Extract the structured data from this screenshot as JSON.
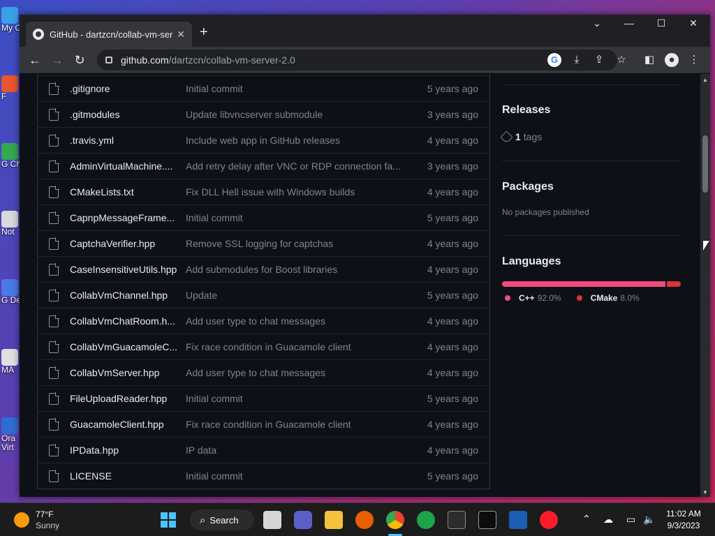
{
  "desktop": {
    "icons": [
      {
        "label": "My C",
        "color": "#3aa0e8"
      },
      {
        "label": "F",
        "color": "#e8552e"
      },
      {
        "label": "G Ch",
        "color": "#34a853"
      },
      {
        "label": "Not",
        "color": "#d9d9d9"
      },
      {
        "label": "G De",
        "color": "#4a7ae8"
      },
      {
        "label": "MA",
        "color": "#e0e0e0"
      },
      {
        "label": "Ora Virt",
        "color": "#2d6ed3"
      }
    ]
  },
  "browser": {
    "tab_title": "GitHub - dartzcn/collab-vm-serve",
    "url_domain": "github.com",
    "url_path": "/dartzcn/collab-vm-server-2.0"
  },
  "files": [
    {
      "name": ".gitignore",
      "message": "Initial commit",
      "date": "5 years ago"
    },
    {
      "name": ".gitmodules",
      "message": "Update libvncserver submodule",
      "date": "3 years ago"
    },
    {
      "name": ".travis.yml",
      "message": "Include web app in GitHub releases",
      "date": "4 years ago"
    },
    {
      "name": "AdminVirtualMachine....",
      "message": "Add retry delay after VNC or RDP connection fa...",
      "date": "3 years ago"
    },
    {
      "name": "CMakeLists.txt",
      "message": "Fix DLL Hell issue with Windows builds",
      "date": "4 years ago"
    },
    {
      "name": "CapnpMessageFrame...",
      "message": "Initial commit",
      "date": "5 years ago"
    },
    {
      "name": "CaptchaVerifier.hpp",
      "message": "Remove SSL logging for captchas",
      "date": "4 years ago"
    },
    {
      "name": "CaseInsensitiveUtils.hpp",
      "message": "Add submodules for Boost libraries",
      "date": "4 years ago"
    },
    {
      "name": "CollabVmChannel.hpp",
      "message": "Update",
      "date": "5 years ago"
    },
    {
      "name": "CollabVmChatRoom.h...",
      "message": "Add user type to chat messages",
      "date": "4 years ago"
    },
    {
      "name": "CollabVmGuacamoleC...",
      "message": "Fix race condition in Guacamole client",
      "date": "4 years ago"
    },
    {
      "name": "CollabVmServer.hpp",
      "message": "Add user type to chat messages",
      "date": "4 years ago"
    },
    {
      "name": "FileUploadReader.hpp",
      "message": "Initial commit",
      "date": "5 years ago"
    },
    {
      "name": "GuacamoleClient.hpp",
      "message": "Fix race condition in Guacamole client",
      "date": "4 years ago"
    },
    {
      "name": "IPData.hpp",
      "message": "IP data",
      "date": "4 years ago"
    },
    {
      "name": "LICENSE",
      "message": "Initial commit",
      "date": "5 years ago"
    }
  ],
  "sidebar": {
    "releases_title": "Releases",
    "tags_count": "1",
    "tags_label": "tags",
    "packages_title": "Packages",
    "packages_empty": "No packages published",
    "languages_title": "Languages",
    "languages": [
      {
        "name": "C++",
        "percent": "92.0%",
        "value": 92.0,
        "color": "#f34b7d"
      },
      {
        "name": "CMake",
        "percent": "8.0%",
        "value": 8.0,
        "color": "#da3434"
      }
    ]
  },
  "taskbar": {
    "weather_temp": "77°F",
    "weather_desc": "Sunny",
    "search_label": "Search",
    "time": "11:02 AM",
    "date": "9/3/2023"
  }
}
